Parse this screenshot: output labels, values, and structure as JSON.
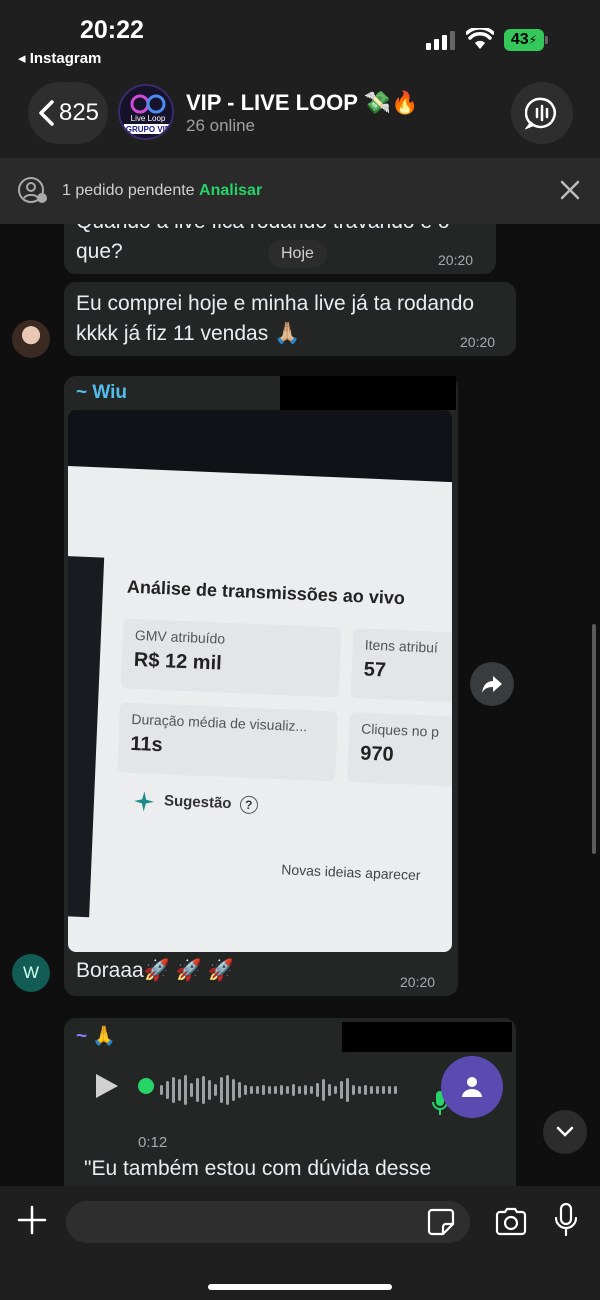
{
  "status_bar": {
    "time": "20:22",
    "back_app": "◂ Instagram",
    "battery": "43"
  },
  "header": {
    "back_count": "825",
    "group_name": "VIP - LIVE LOOP 💸🔥",
    "online": "26 online",
    "avatar_text": {
      "line1": "Live Loop",
      "line2": "GRUPO VIP"
    }
  },
  "pending_banner": {
    "text": "1 pedido pendente",
    "action": "Analisar"
  },
  "chat": {
    "date_pill": "Hoje",
    "messages": [
      {
        "text": "Quando a live fica rodando travando e o que?",
        "time": "20:20"
      },
      {
        "text": "Eu comprei hoje e minha live já ta rodando kkkk já fiz 11 vendas 🙏🏼",
        "time": "20:20"
      },
      {
        "sender": "~ Wiu",
        "sender_initial": "W",
        "caption": "Boraaa🚀 🚀 🚀",
        "time": "20:20",
        "photo": {
          "title": "Análise de transmissões ao vivo",
          "cards": [
            {
              "label": "GMV atribuído",
              "value": "R$ 12 mil"
            },
            {
              "label": "Itens atribuí",
              "value": "57"
            },
            {
              "label": "Duração média de visualiz...",
              "value": "11s"
            },
            {
              "label": "Cliques no p",
              "value": "970"
            }
          ],
          "suggestion": "Sugestão",
          "footer": "Novas ideias aparecer"
        }
      },
      {
        "sender": "~ 🙏",
        "voice_duration": "0:12",
        "transcript": "\"Eu também estou com dúvida desse"
      }
    ]
  },
  "colors": {
    "accent": "#25d366",
    "sender_wiu": "#53bdeb",
    "sender_pray": "#8e7cff",
    "bubble": "#242626"
  }
}
